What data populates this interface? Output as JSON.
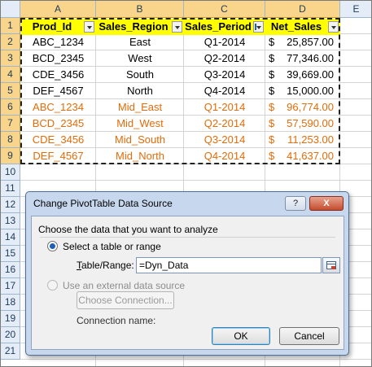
{
  "sheet": {
    "columns": [
      "A",
      "B",
      "C",
      "D",
      "E"
    ],
    "rows": [
      "1",
      "2",
      "3",
      "4",
      "5",
      "6",
      "7",
      "8",
      "9",
      "10",
      "11",
      "12",
      "13",
      "14",
      "15",
      "16",
      "17",
      "18",
      "19",
      "20",
      "21"
    ],
    "headers": [
      "Prod_Id",
      "Sales_Region",
      "Sales_Period",
      "Net_Sales"
    ],
    "currency_symbol": "$",
    "data": [
      {
        "prod": "ABC_1234",
        "region": "East",
        "period": "Q1-2014",
        "sales": "25,857.00",
        "highlight": false
      },
      {
        "prod": "BCD_2345",
        "region": "West",
        "period": "Q2-2014",
        "sales": "77,346.00",
        "highlight": false
      },
      {
        "prod": "CDE_3456",
        "region": "South",
        "period": "Q3-2014",
        "sales": "39,669.00",
        "highlight": false
      },
      {
        "prod": "DEF_4567",
        "region": "North",
        "period": "Q4-2014",
        "sales": "15,000.00",
        "highlight": false
      },
      {
        "prod": "ABC_1234",
        "region": "Mid_East",
        "period": "Q1-2014",
        "sales": "96,774.00",
        "highlight": true
      },
      {
        "prod": "BCD_2345",
        "region": "Mid_West",
        "period": "Q2-2014",
        "sales": "57,590.00",
        "highlight": true
      },
      {
        "prod": "CDE_3456",
        "region": "Mid_South",
        "period": "Q3-2014",
        "sales": "11,253.00",
        "highlight": true
      },
      {
        "prod": "DEF_4567",
        "region": "Mid_North",
        "period": "Q4-2014",
        "sales": "41,637.00",
        "highlight": true
      }
    ],
    "colors": {
      "header_fill": "#ffff00",
      "highlight_text": "#e36c09"
    }
  },
  "dialog": {
    "title": "Change PivotTable Data Source",
    "help_button": "?",
    "close_button": "X",
    "instruction": "Choose the data that you want to analyze",
    "option_table": "Select a table or range",
    "table_range_label": "Table/Range:",
    "table_range_value": "=Dyn_Data",
    "option_external": "Use an external data source",
    "choose_connection": "Choose Connection...",
    "connection_name_label": "Connection name:",
    "ok": "OK",
    "cancel": "Cancel"
  }
}
